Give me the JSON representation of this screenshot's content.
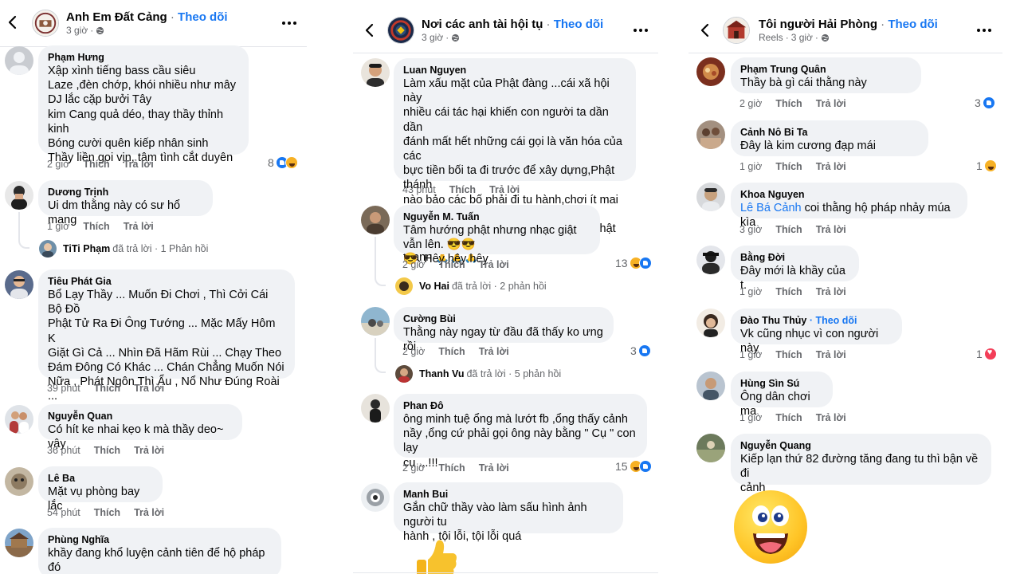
{
  "panels": [
    {
      "page_name": "Anh Em Đất Cảng",
      "follow_label": "Theo dõi",
      "subtitle_prefix": "",
      "time": "3 giờ",
      "comments": [
        {
          "name": "Phạm Hưng",
          "text": "Xập xình tiếng bass cầu siêu\nLaze ,đèn chớp, khói nhiều như mây\nDJ lắc cặp bưởi Tây\nkim Cang quả déo, thay thầy thỉnh kinh\nBóng cười quên kiếp nhân sinh\nThầy liền gọi vịn, tâm tình cắt duyên",
          "time": "2 giờ",
          "like": "Thích",
          "reply": "Trả lời",
          "reactions": "8"
        },
        {
          "name": "Dương Trịnh",
          "text": "Ui dm thằng này có sư hổ mang",
          "time": "1 giờ",
          "like": "Thích",
          "reply": "Trả lời",
          "thread_name": "TiTi Phạm",
          "thread_action": "đã trả lời",
          "thread_count": "· 1 Phản hồi"
        },
        {
          "name": "Tiêu Phát Gia",
          "text": "Bổ Lạy Thầy ... Muốn Đi Chơi , Thì Cởi Cái Bộ Đồ\nPhật Tử Ra Đi Ông Tướng ... Mặc Mấy Hôm K\nGiặt Gì Cả ... Nhìn Đã Hãm Rùi ... Chạy Theo\nĐám Đông Có Khác ... Chán Chẳng Muốn Nói\nNữa , Phát Ngôn Thì Ẩu , Nổ Như Đúng Roài ...\n😮‍💨",
          "time": "39 phút",
          "like": "Thích",
          "reply": "Trả lời"
        },
        {
          "name": "Nguyễn Quan",
          "text": "Có hít ke nhai kẹo k mà thầy deo~ vậy",
          "time": "36 phút",
          "like": "Thích",
          "reply": "Trả lời"
        },
        {
          "name": "Lê Ba",
          "text": "Mặt vụ phòng bay lắc",
          "time": "54 phút",
          "like": "Thích",
          "reply": "Trả lời"
        },
        {
          "name": "Phùng Nghĩa",
          "text": "khầy đang khổ luyện cảnh tiên để hộ pháp đó\nmấy ba",
          "time": "",
          "like": "",
          "reply": ""
        }
      ]
    },
    {
      "page_name": "Nơi các anh tài hội tụ",
      "follow_label": "Theo dõi",
      "time": "3 giờ",
      "comments": [
        {
          "name": "Luan Nguyen",
          "text": "Làm xấu mặt của Phật đàng ...cái xã hội này\nnhiều cái tác hại khiến con người ta dần dần\nđánh mất hết những cái gọi là văn hóa của các\nbực tiền bối ta đi trước để xây dựng,Phật thánh\nnào bảo các bố phải đi tu hành,chơi ít mai Thuý\nthôi,chơi nhiều lên lúc nào cũng gặp Phật gặp\nthánh 🙏🙏🙏",
          "time": "43 phút",
          "like": "Thích",
          "reply": "Trả lời"
        },
        {
          "name": "Nguyễn M. Tuấn",
          "text": "Tâm hướng phật nhưng nhạc giật vẫn lên. 😎😎\n😎. Hêy hêy hêy",
          "time": "2 giờ",
          "like": "Thích",
          "reply": "Trả lời",
          "reactions": "13",
          "thread_name": "Vo Hai",
          "thread_action": "đã trả lời",
          "thread_count": "· 2 phản hồi"
        },
        {
          "name": "Cường Bùi",
          "text": "Thằng này ngay từ đầu đã thấy ko ưng rồi",
          "time": "2 giờ",
          "like": "Thích",
          "reply": "Trả lời",
          "reactions": "3",
          "thread_name": "Thanh Vu",
          "thread_action": "đã trả lời",
          "thread_count": "· 5 phản hồi"
        },
        {
          "name": "Phan Đô",
          "text": "ông minh tuệ ổng mà lướt fb ,ổng thấy cảnh\nnầy ,ổng cứ phải gọi ông này bằng \" Cụ \" con lạy\ncụ ...!!!",
          "time": "2 giờ",
          "like": "Thích",
          "reply": "Trả lời",
          "reactions": "15"
        },
        {
          "name": "Manh Bui",
          "text": "Gắn chữ thầy vào làm sấu hình ảnh người tu\nhành , tội lỗi, tội lỗi quá",
          "time": "",
          "like": "",
          "reply": ""
        }
      ]
    },
    {
      "page_name": "Tôi người Hải Phòng",
      "follow_label": "Theo dõi",
      "subtitle_prefix": "Reels",
      "time": "3 giờ",
      "comments": [
        {
          "name": "Phạm Trung Quân",
          "text": "Thầy bà gì cái thằng này",
          "time": "2 giờ",
          "like": "Thích",
          "reply": "Trả lời",
          "reactions": "3"
        },
        {
          "name": "Cảnh Nô Bi Ta",
          "text": "Đây là kim cương đạp mái",
          "time": "1 giờ",
          "like": "Thích",
          "reply": "Trả lời",
          "reactions": "1"
        },
        {
          "name": "Khoa Nguyen",
          "mention": "Lê Bá Cảnh",
          "text": " coi thằng hộ pháp nhảy múa kìa",
          "time": "3 giờ",
          "like": "Thích",
          "reply": "Trả lời"
        },
        {
          "name": "Bằng Đời",
          "text": "Đây mới là khầy của t.",
          "time": "1 giờ",
          "like": "Thích",
          "reply": "Trả lời"
        },
        {
          "name": "Đào Thu Thủy",
          "name_follow": "· Theo dõi",
          "text": "Vk cũng nhục vì con người này",
          "time": "1 giờ",
          "like": "Thích",
          "reply": "Trả lời",
          "reactions": "1"
        },
        {
          "name": "Hùng Sìn Sú",
          "text": "Ông dân chơi ma",
          "time": "1 giờ",
          "like": "Thích",
          "reply": "Trả lời"
        },
        {
          "name": "Nguyễn Quang",
          "text": "Kiếp lạn thứ 82 đường tăng đang tu thì bận về đi\ncảnh",
          "time": "",
          "like": "",
          "reply": ""
        }
      ]
    }
  ],
  "colors": {
    "accent": "#1877f2",
    "bubble": "#f0f2f5",
    "meta": "#65676b"
  },
  "icons": [
    "back-arrow-icon",
    "globe-icon",
    "more-icon",
    "like-reaction-icon",
    "haha-reaction-icon",
    "love-reaction-icon"
  ]
}
